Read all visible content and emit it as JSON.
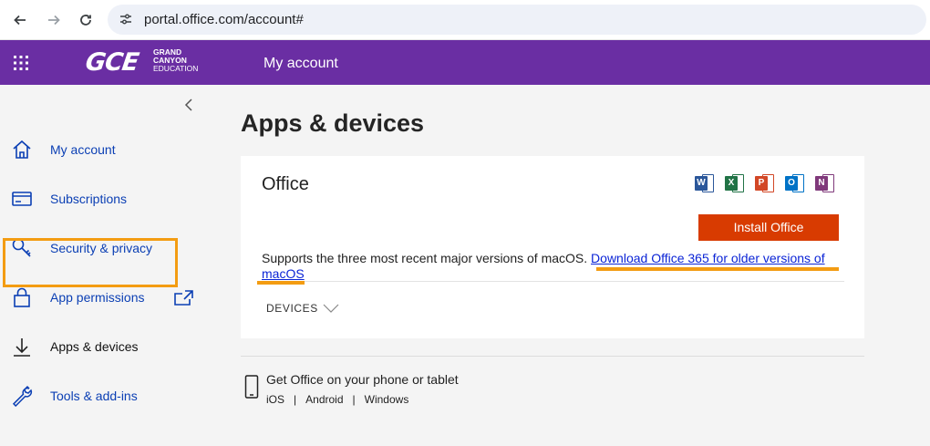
{
  "browser": {
    "url": "portal.office.com/account#"
  },
  "header": {
    "logo_mark": "GCE",
    "logo_lines": [
      "GRAND",
      "CANYON",
      "EDUCATION"
    ],
    "title": "My account"
  },
  "sidebar": {
    "items": [
      {
        "label": "My account",
        "icon": "home-icon"
      },
      {
        "label": "Subscriptions",
        "icon": "card-icon"
      },
      {
        "label": "Security & privacy",
        "icon": "key-icon"
      },
      {
        "label": "App permissions",
        "icon": "lock-icon"
      },
      {
        "label": "Apps & devices",
        "icon": "download-icon",
        "active": true
      },
      {
        "label": "Tools & add-ins",
        "icon": "wrench-icon"
      }
    ]
  },
  "main": {
    "title": "Apps & devices",
    "office": {
      "heading": "Office",
      "apps": [
        {
          "letter": "W",
          "name": "word-icon",
          "color": "#2b579a"
        },
        {
          "letter": "X",
          "name": "excel-icon",
          "color": "#217346"
        },
        {
          "letter": "P",
          "name": "powerpoint-icon",
          "color": "#d24726"
        },
        {
          "letter": "O",
          "name": "outlook-icon",
          "color": "#0072c6"
        },
        {
          "letter": "N",
          "name": "onenote-icon",
          "color": "#80397b"
        }
      ],
      "install_label": "Install Office",
      "support_text": "Supports the three most recent major versions of macOS.",
      "download_link": "Download Office 365 for older versions of macOS",
      "devices_label": "DEVICES"
    },
    "mobile": {
      "text": "Get Office on your phone or tablet",
      "platforms": [
        "iOS",
        "Android",
        "Windows"
      ],
      "separator": "|"
    }
  },
  "colors": {
    "brand": "#6a2ea3",
    "install": "#d83b01",
    "link": "#0b3fb4",
    "highlight": "#f39c12"
  }
}
